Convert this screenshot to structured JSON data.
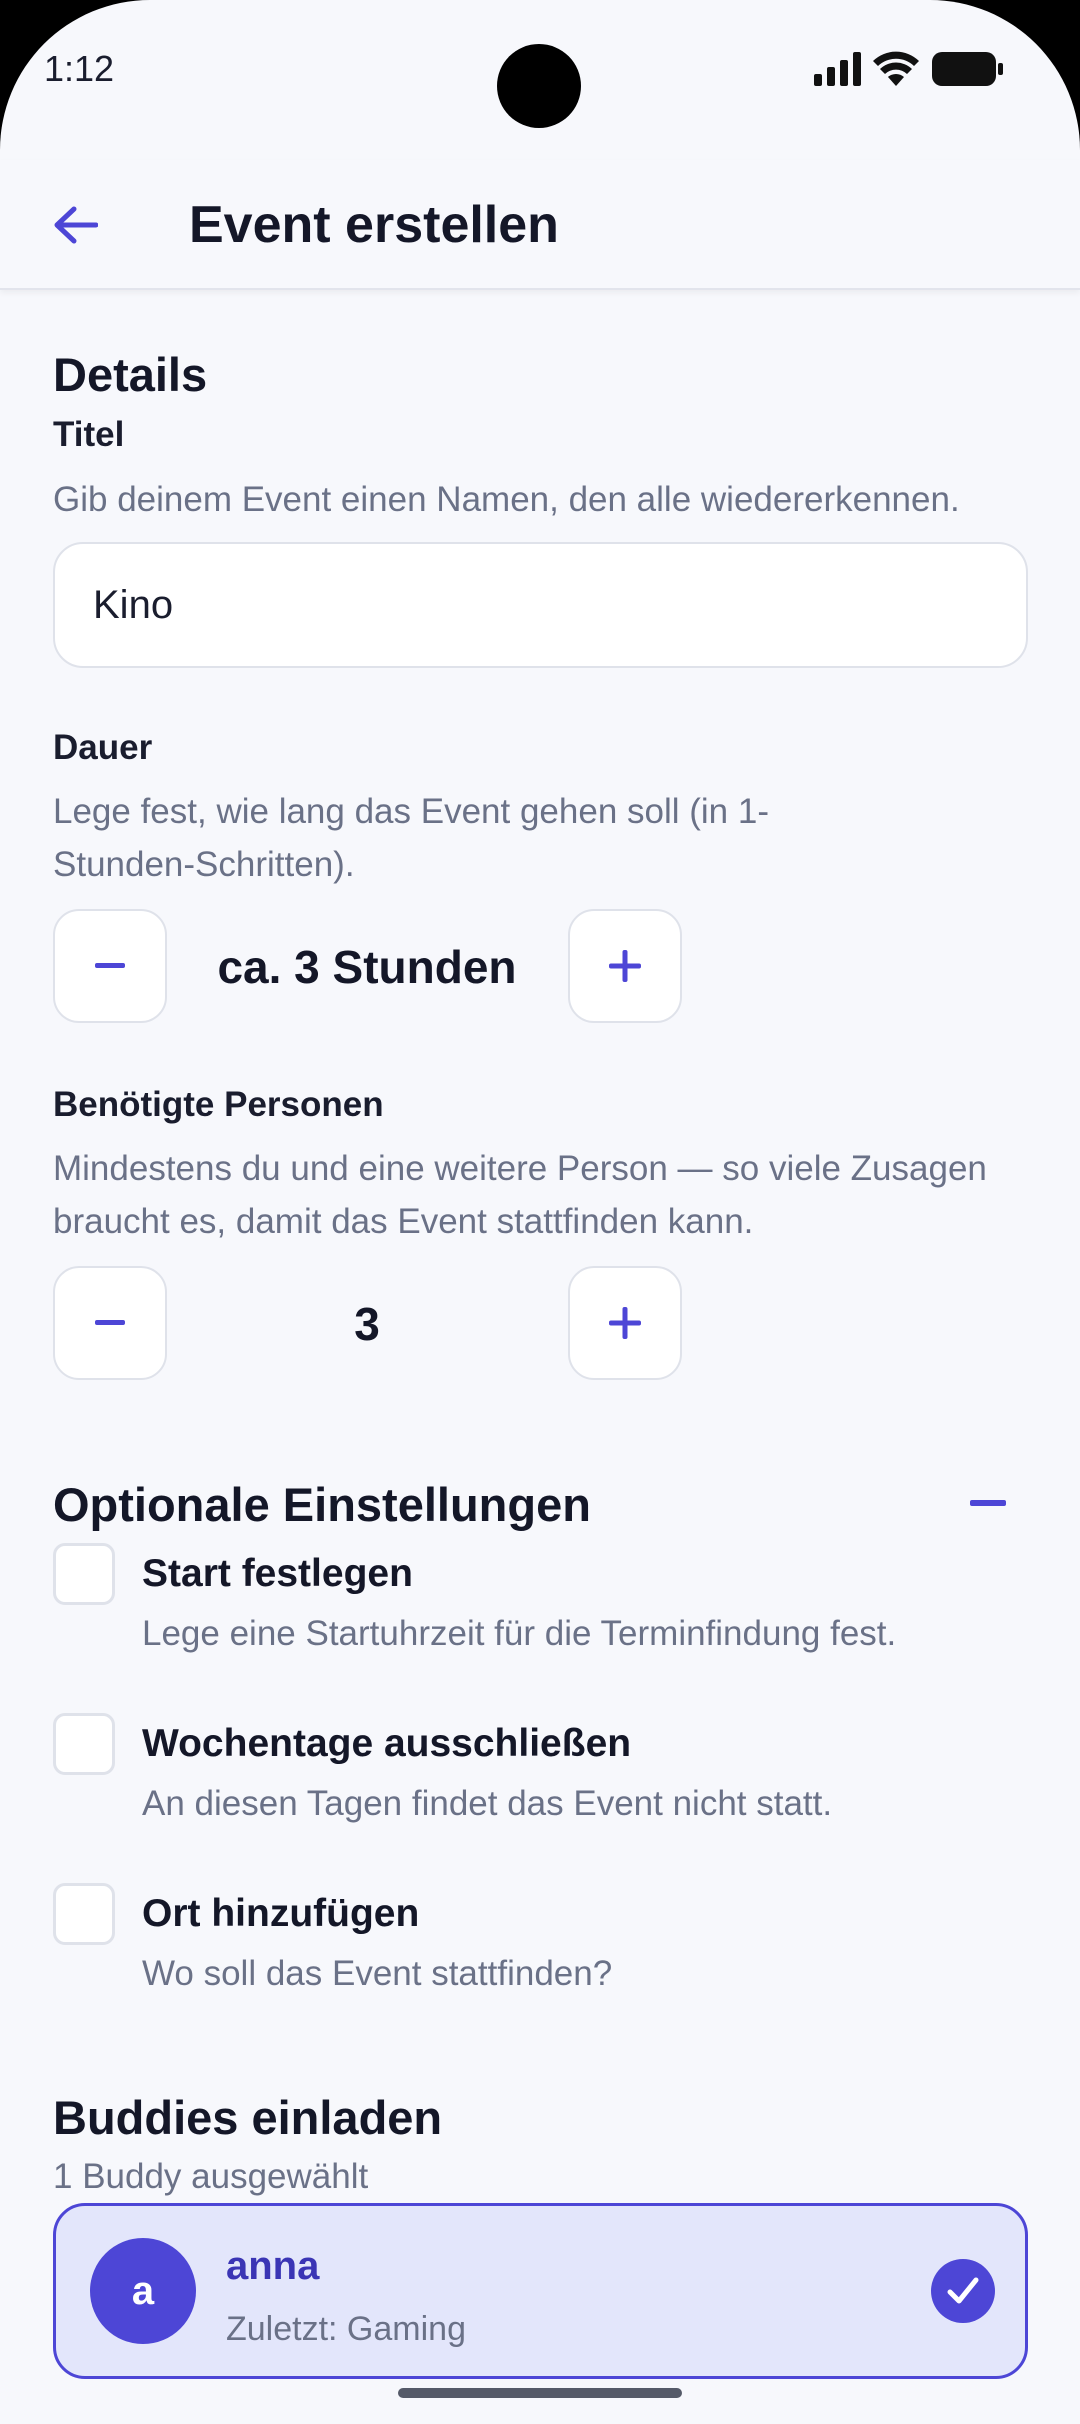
{
  "status_bar": {
    "time": "1:12"
  },
  "appbar": {
    "title": "Event erstellen"
  },
  "details": {
    "section_title": "Details",
    "title_field": {
      "label": "Titel",
      "helper": "Gib deinem Event einen Namen, den alle wiedererkennen.",
      "value": "Kino"
    },
    "duration": {
      "label": "Dauer",
      "helper": "Lege fest, wie lang das Event gehen soll (in 1-Stunden-Schritten).",
      "value": "ca. 3 Stunden"
    },
    "persons": {
      "label": "Benötigte Personen",
      "helper": "Mindestens du und eine weitere Person — so viele Zusagen braucht es, damit das Event stattfinden kann.",
      "value": "3"
    }
  },
  "optional": {
    "section_title": "Optionale Einstellungen",
    "options": [
      {
        "title": "Start festlegen",
        "desc": "Lege eine Startuhrzeit für die Terminfindung fest.",
        "checked": false
      },
      {
        "title": "Wochentage ausschließen",
        "desc": "An diesen Tagen findet das Event nicht statt.",
        "checked": false
      },
      {
        "title": "Ort hinzufügen",
        "desc": "Wo soll das Event stattfinden?",
        "checked": false
      }
    ]
  },
  "buddies": {
    "section_title": "Buddies einladen",
    "selected_count": "1 Buddy ausgewählt",
    "list": [
      {
        "initial": "a",
        "name": "anna",
        "subtitle": "Zuletzt: Gaming",
        "selected": true
      }
    ]
  },
  "colors": {
    "accent": "#4d46d6",
    "background": "#f7f8fc",
    "text_primary": "#141728",
    "text_secondary": "#6a7187",
    "selected_card": "#e3e6fb"
  },
  "icons": {
    "back": "arrow-left-icon",
    "minus": "minus-icon",
    "plus": "plus-icon",
    "collapse": "minus-icon",
    "check": "checkmark-icon"
  }
}
